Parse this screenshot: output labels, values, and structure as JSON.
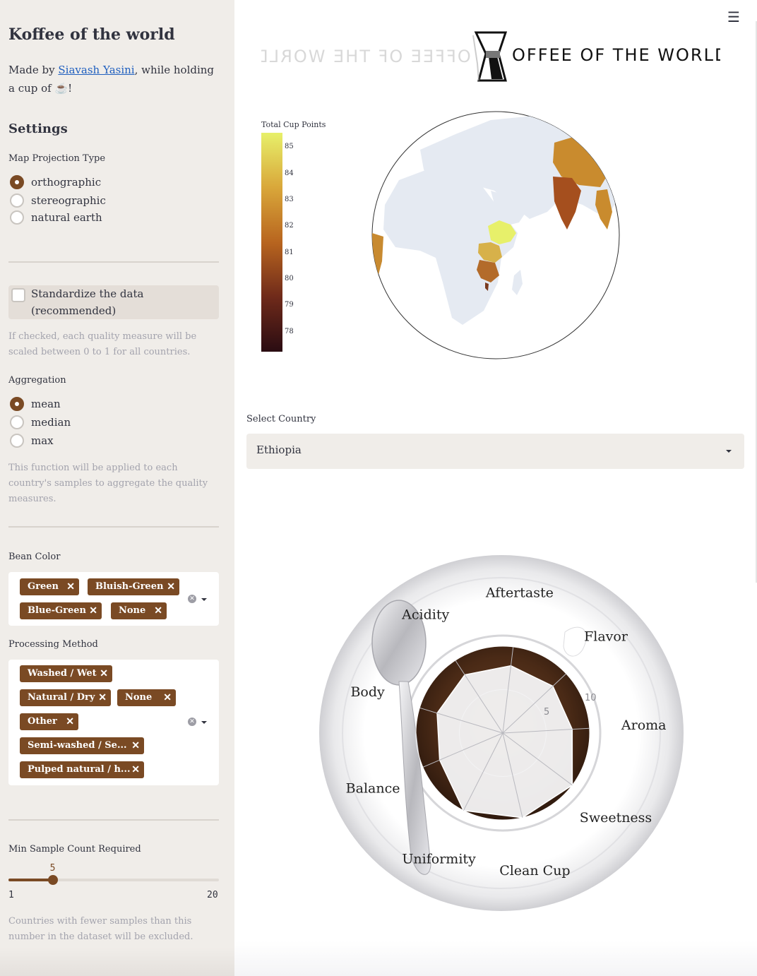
{
  "sidebar": {
    "title": "Koffee of the world",
    "made_by_prefix": "Made by ",
    "author": "Siavash Yasini",
    "made_by_suffix": ", while holding a cup of ☕!",
    "settings_heading": "Settings",
    "projection": {
      "label": "Map Projection Type",
      "options": [
        "orthographic",
        "stereographic",
        "natural earth"
      ],
      "selected": "orthographic"
    },
    "standardize": {
      "label": "Standardize the data (recommended)",
      "checked": false,
      "help": "If checked, each quality measure will be scaled between 0 to 1 for all countries."
    },
    "aggregation": {
      "label": "Aggregation",
      "options": [
        "mean",
        "median",
        "max"
      ],
      "selected": "mean",
      "help": "This function will be applied to each country's samples to aggregate the quality measures."
    },
    "bean_color": {
      "label": "Bean Color",
      "tags": [
        "Green",
        "Bluish-Green",
        "Blue-Green",
        "None"
      ]
    },
    "processing": {
      "label": "Processing Method",
      "tags": [
        "Washed / Wet",
        "Natural / Dry",
        "None",
        "Other",
        "Semi-washed / Se...",
        "Pulped natural / h..."
      ]
    },
    "min_samples": {
      "label": "Min Sample Count Required",
      "value": "5",
      "min": "1",
      "max": "20",
      "fraction": 0.21,
      "help": "Countries with fewer samples than this number in the dataset will be excluded."
    }
  },
  "main": {
    "menu_icon": "hamburger-icon",
    "logo_text": "OFFEE OF THE WORLD",
    "logo_mirror_text": "OFFEE OF THE WORLD",
    "select_country": {
      "label": "Select Country",
      "value": "Ethiopia"
    },
    "map": {
      "colorbar_title": "Total Cup Points",
      "ticks": [
        "85",
        "84",
        "83",
        "82",
        "81",
        "80",
        "79",
        "78"
      ]
    },
    "radar": {
      "axes": [
        "Aftertaste",
        "Flavor",
        "Aroma",
        "Sweetness",
        "Clean Cup",
        "Uniformity",
        "Balance",
        "Body",
        "Acidity"
      ],
      "ring_labels": [
        "5",
        "10"
      ]
    }
  },
  "chart_data": {
    "type": "radar",
    "title": "",
    "categories": [
      "Aftertaste",
      "Flavor",
      "Aroma",
      "Sweetness",
      "Clean Cup",
      "Uniformity",
      "Balance",
      "Body",
      "Acidity"
    ],
    "values": [
      7.8,
      7.9,
      8.0,
      10,
      10,
      10,
      7.9,
      7.9,
      8.0
    ],
    "rlim": [
      0,
      10
    ],
    "grid": true
  }
}
